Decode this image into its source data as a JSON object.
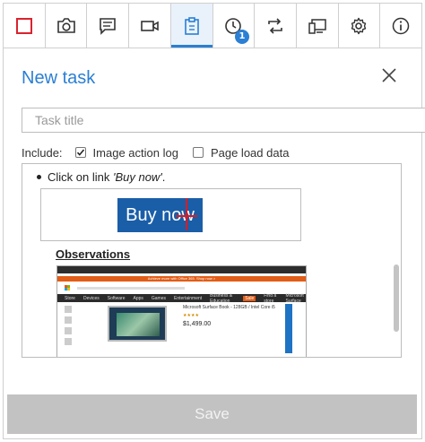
{
  "toolbar": {
    "items": [
      {
        "icon": "record-stop-icon",
        "active": false
      },
      {
        "icon": "camera-icon",
        "active": false
      },
      {
        "icon": "comment-icon",
        "active": false
      },
      {
        "icon": "video-camera-icon",
        "active": false
      },
      {
        "icon": "clipboard-icon",
        "active": true
      },
      {
        "icon": "history-clock-icon",
        "active": false
      },
      {
        "icon": "repeat-icon",
        "active": false
      },
      {
        "icon": "device-icon",
        "active": false
      },
      {
        "icon": "gear-icon",
        "active": false
      },
      {
        "icon": "info-icon",
        "active": false
      }
    ],
    "history_badge": "1",
    "accent": "#2b7fd4",
    "stop_color": "#d9232e"
  },
  "panel": {
    "title": "New task",
    "task_title_placeholder": "Task title",
    "task_title_value": "",
    "include_label": "Include:",
    "image_action_log_label": "Image action log",
    "image_action_log_checked": true,
    "page_load_data_label": "Page load data",
    "page_load_data_checked": false
  },
  "preview": {
    "step_prefix": "Click on link ",
    "step_target": "'Buy now'",
    "step_suffix": ".",
    "button_text": "Buy now",
    "observations_label": "Observations",
    "website": {
      "banner": "Achieve more with Office 365. Shop now >",
      "nav_items": [
        "Store",
        "Devices",
        "Software",
        "Apps",
        "Games",
        "Entertainment",
        "Business & Education",
        "Sale",
        "Find a store",
        "Microsoft Surface"
      ],
      "product_name": "Microsoft Surface Book - 128GB / Intel Core i5",
      "price": "$1,499.00"
    }
  },
  "footer": {
    "save_label": "Save"
  }
}
